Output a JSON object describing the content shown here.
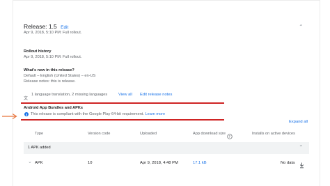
{
  "release": {
    "title": "Release: 1.5",
    "edit_label": "Edit",
    "rollout_meta": "Apr 9, 2018, 5:10 PM: Full rollout."
  },
  "rollout_history": {
    "heading": "Rollout history",
    "entry": "Apr 9, 2018, 5:10 PM: Full rollout."
  },
  "whats_new": {
    "heading": "What's new in this release?",
    "default_lang": "Default – English (United States) – en-US",
    "notes": "Release notes: this is release."
  },
  "translations": {
    "summary": "1 language translation, 2 missing languages",
    "view_all": "View all",
    "edit_notes": "Edit release notes"
  },
  "bundles": {
    "heading": "Android App Bundles and APKs",
    "compliance_text": "This release is compliant with the Google Play 64-bit requirement.",
    "learn_more": "Learn more",
    "expand_all": "Expand all"
  },
  "table": {
    "headers": {
      "type": "Type",
      "version_code": "Version code",
      "uploaded": "Uploaded",
      "download_size": "App download size",
      "installs": "Installs on active devices"
    },
    "group_label": "1 APK added",
    "row": {
      "type": "APK",
      "version_code": "10",
      "uploaded": "Apr 9, 2018, 4:48 PM",
      "download_size": "17.1 kB",
      "installs": "No data"
    }
  },
  "colors": {
    "accent": "#1a73e8",
    "annotation_red": "#cf2424",
    "arrow_orange": "#e8733a"
  }
}
